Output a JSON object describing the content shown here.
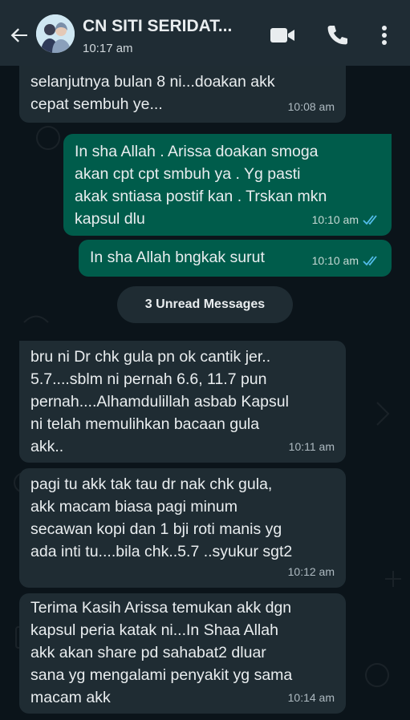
{
  "header": {
    "contact_name": "CN SITI SERIDAT...",
    "last_seen": "10:17 am"
  },
  "messages": [
    {
      "direction": "in",
      "text": "selanjutnya bulan 8 ni...doakan akk\ncepat sembuh ye...",
      "time": "10:08 am"
    },
    {
      "direction": "out",
      "text": "In sha Allah . Arissa doakan smoga\nakan cpt cpt smbuh ya . Yg pasti\nakak sntiasa postif kan . Trskan mkn\nkapsul dlu",
      "time": "10:10 am",
      "status": "read"
    },
    {
      "direction": "out",
      "text": "In sha Allah bngkak surut",
      "time": "10:10 am",
      "status": "read"
    },
    {
      "direction": "in",
      "text": "bru ni Dr chk gula pn ok cantik jer..\n5.7....sblm ni pernah 6.6, 11.7 pun\npernah....Alhamdulillah asbab Kapsul\nni telah memulihkan bacaan gula\nakk..",
      "time": "10:11 am"
    },
    {
      "direction": "in",
      "text": "pagi tu akk tak tau dr nak chk gula,\nakk macam biasa pagi minum\nsecawan kopi dan 1 bji roti manis yg\nada inti tu....bila chk..5.7 ..syukur sgt2",
      "time": "10:12 am"
    },
    {
      "direction": "in",
      "text": "Terima Kasih Arissa temukan akk dgn\nkapsul peria katak ni...In Shaa Allah\nakk akan share pd sahabat2 dluar\nsana yg mengalami penyakit yg sama\nmacam akk",
      "time": "10:14 am"
    }
  ],
  "unread_banner": "3 Unread Messages",
  "colors": {
    "header_bg": "#1f2c34",
    "chat_bg": "#0b141a",
    "incoming_bubble": "#1f2c33",
    "outgoing_bubble": "#005c4b",
    "read_tick": "#53bdeb"
  }
}
